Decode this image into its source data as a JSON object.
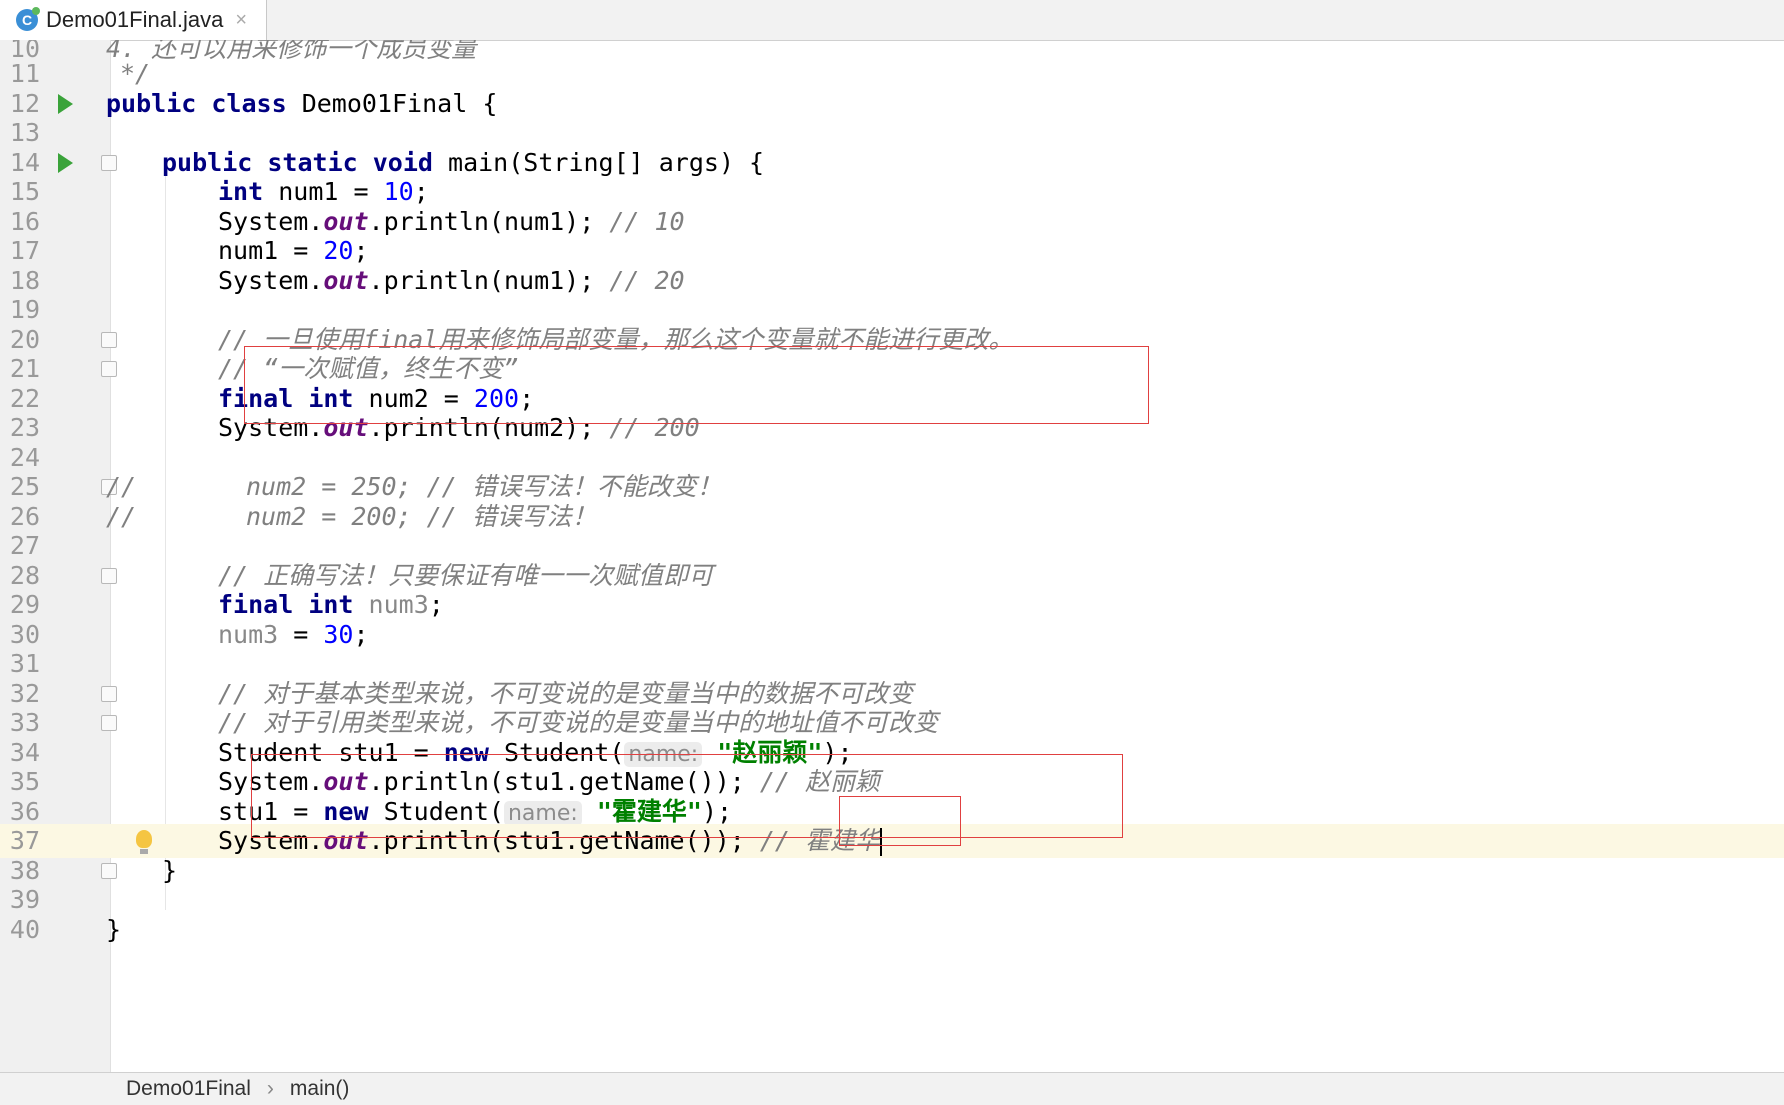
{
  "tab": {
    "icon": "java-class-icon",
    "label": "Demo01Final.java",
    "close": "×"
  },
  "lines": [
    {
      "n": "10"
    },
    {
      "n": "11"
    },
    {
      "n": "12"
    },
    {
      "n": "13"
    },
    {
      "n": "14"
    },
    {
      "n": "15"
    },
    {
      "n": "16"
    },
    {
      "n": "17"
    },
    {
      "n": "18"
    },
    {
      "n": "19"
    },
    {
      "n": "20"
    },
    {
      "n": "21"
    },
    {
      "n": "22"
    },
    {
      "n": "23"
    },
    {
      "n": "24"
    },
    {
      "n": "25"
    },
    {
      "n": "26"
    },
    {
      "n": "27"
    },
    {
      "n": "28"
    },
    {
      "n": "29"
    },
    {
      "n": "30"
    },
    {
      "n": "31"
    },
    {
      "n": "32"
    },
    {
      "n": "33"
    },
    {
      "n": "34"
    },
    {
      "n": "35"
    },
    {
      "n": "36"
    },
    {
      "n": "37"
    },
    {
      "n": "38"
    },
    {
      "n": "39"
    },
    {
      "n": "40"
    }
  ],
  "code": {
    "l10": "4. 还可以用来修饰一个成员变量",
    "l11": "*/",
    "l12": {
      "kw1": "public",
      "kw2": "class",
      "name": "Demo01Final",
      "brace": "{"
    },
    "l14": {
      "kw1": "public",
      "kw2": "static",
      "kw3": "void",
      "rest": "main(String[] args) {"
    },
    "l15": {
      "kw": "int",
      "a": "num1 = ",
      "num": "10",
      "end": ";"
    },
    "l16": {
      "a": "System.",
      "fld": "out",
      "b": ".println(num1); ",
      "cm": "// 10"
    },
    "l17": {
      "a": "num1 = ",
      "num": "20",
      "end": ";"
    },
    "l18": {
      "a": "System.",
      "fld": "out",
      "b": ".println(num1); ",
      "cm": "// 20"
    },
    "l20": "// 一旦使用final用来修饰局部变量，那么这个变量就不能进行更改。",
    "l21": "// “一次赋值，终生不变”",
    "l22": {
      "kw1": "final",
      "kw2": "int",
      "a": "num2 = ",
      "num": "200",
      "end": ";"
    },
    "l23": {
      "a": "System.",
      "fld": "out",
      "b": ".println(num2); ",
      "cm": "// 200"
    },
    "l25": {
      "slash": "//",
      "body": "num2 = 250; // 错误写法！不能改变！"
    },
    "l26": {
      "slash": "//",
      "body": "num2 = 200; // 错误写法！"
    },
    "l28": "// 正确写法！只要保证有唯一一次赋值即可",
    "l29": {
      "kw1": "final",
      "kw2": "int",
      "a": "num3",
      "end": ";"
    },
    "l30": {
      "a": "num3",
      "b": " = ",
      "num": "30",
      "end": ";"
    },
    "l32": "// 对于基本类型来说，不可变说的是变量当中的数据不可改变",
    "l33": "// 对于引用类型来说，不可变说的是变量当中的地址值不可改变",
    "l34": {
      "a": "Student stu1 = ",
      "kw": "new",
      "b": " Student(",
      "hint": "name:",
      "str": "\"赵丽颖\"",
      "end": ");"
    },
    "l35": {
      "a": "System.",
      "fld": "out",
      "b": ".println(stu1.getName()); ",
      "cm": "// 赵丽颖"
    },
    "l36": {
      "a": "stu1 = ",
      "kw": "new",
      "b": " Student(",
      "hint": "name:",
      "str": "\"霍建华\"",
      "end": ");"
    },
    "l37": {
      "a": "System.",
      "fld": "out",
      "b": ".println(stu1.getName()); ",
      "cm": "// 霍建华"
    },
    "l38": "}",
    "l40": "}"
  },
  "gutter_icons": {
    "run": "run-icon",
    "fold": "fold-icon",
    "bulb": "lightbulb-icon"
  },
  "breadcrumb": {
    "class": "Demo01Final",
    "sep": "›",
    "method": "main()"
  },
  "colors": {
    "keyword": "#000080",
    "number": "#0000ff",
    "comment": "#808080",
    "field": "#660e7a",
    "string": "#008000",
    "annotation_box": "#e04040",
    "current_line": "#fcf8e3"
  }
}
